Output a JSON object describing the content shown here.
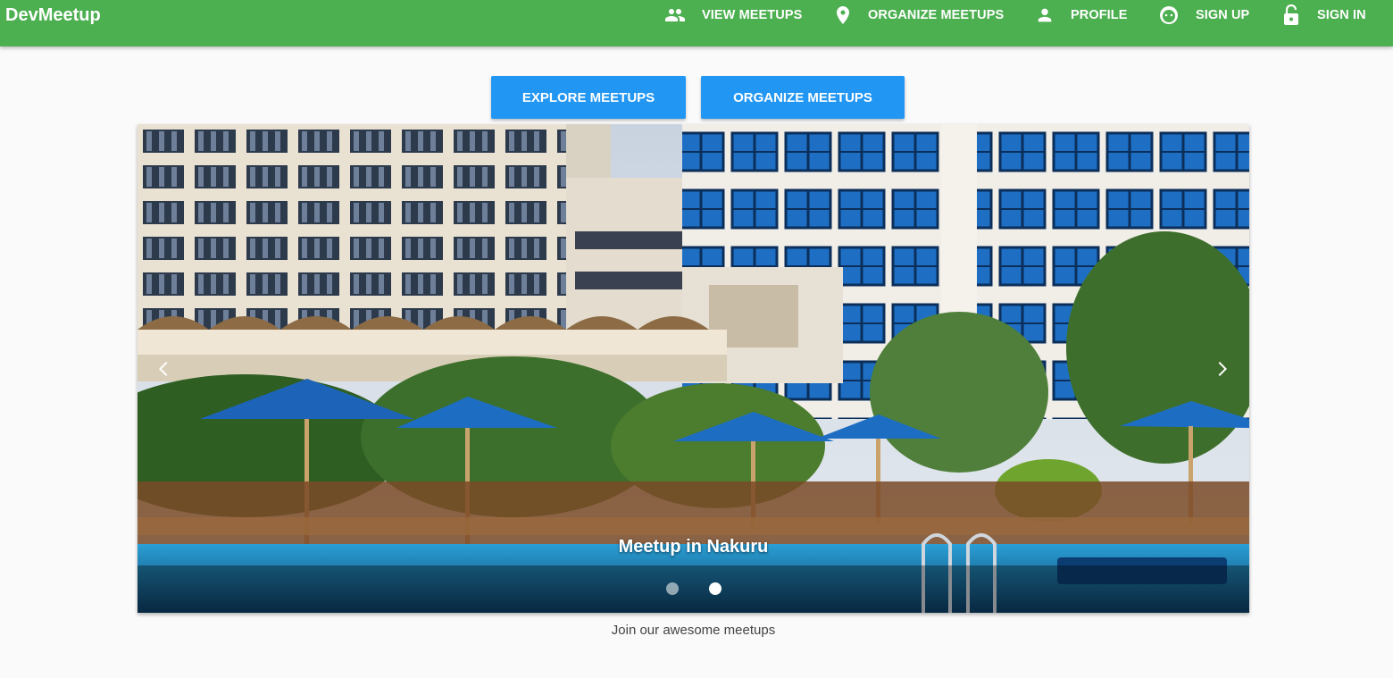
{
  "app": {
    "brand": "DevMeetup"
  },
  "nav": {
    "items": [
      {
        "label": "VIEW MEETUPS",
        "icon": "people-icon"
      },
      {
        "label": "ORGANIZE MEETUPS",
        "icon": "location-pin-icon"
      },
      {
        "label": "PROFILE",
        "icon": "person-icon"
      },
      {
        "label": "SIGN UP",
        "icon": "face-icon"
      },
      {
        "label": "SIGN IN",
        "icon": "lock-open-icon"
      }
    ]
  },
  "actions": {
    "explore_label": "EXPLORE MEETUPS",
    "organize_label": "ORGANIZE MEETUPS"
  },
  "carousel": {
    "caption": "Meetup in Nakuru",
    "slide_count": 2,
    "active_slide": 2,
    "prev_icon": "chevron-left-icon",
    "next_icon": "chevron-right-icon"
  },
  "footer": {
    "tagline": "Join our awesome meetups"
  },
  "colors": {
    "toolbar": "#4caf50",
    "button": "#2196f3",
    "background": "#fafafa"
  }
}
